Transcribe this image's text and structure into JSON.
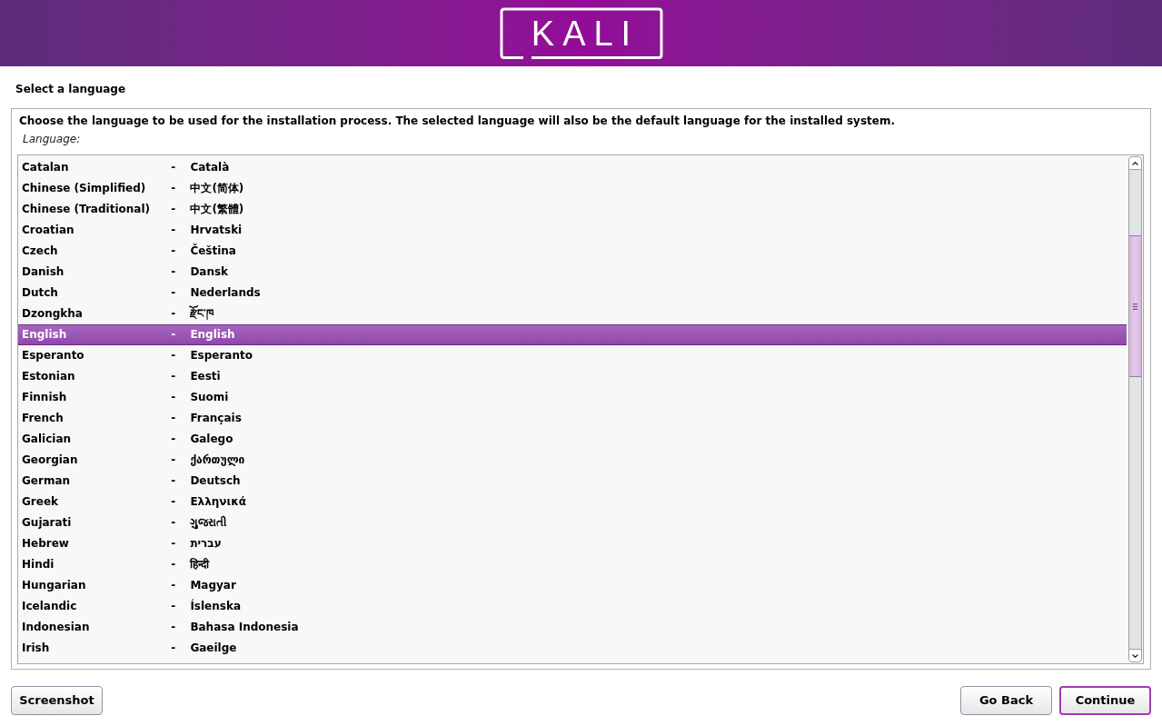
{
  "header": {
    "logo_text": "KALI"
  },
  "page_title": "Select a language",
  "description": "Choose the language to be used for the installation process. The selected language will also be the default language for the installed system.",
  "list_label": "Language:",
  "languages": [
    {
      "name": "Catalan",
      "separator": "-",
      "native": "Català",
      "selected": false
    },
    {
      "name": "Chinese (Simplified)",
      "separator": "-",
      "native": "中文(简体)",
      "selected": false
    },
    {
      "name": "Chinese (Traditional)",
      "separator": "-",
      "native": "中文(繁體)",
      "selected": false
    },
    {
      "name": "Croatian",
      "separator": "-",
      "native": "Hrvatski",
      "selected": false
    },
    {
      "name": "Czech",
      "separator": "-",
      "native": "Čeština",
      "selected": false
    },
    {
      "name": "Danish",
      "separator": "-",
      "native": "Dansk",
      "selected": false
    },
    {
      "name": "Dutch",
      "separator": "-",
      "native": "Nederlands",
      "selected": false
    },
    {
      "name": "Dzongkha",
      "separator": "-",
      "native": "རྫོང་ཁ",
      "selected": false
    },
    {
      "name": "English",
      "separator": "-",
      "native": "English",
      "selected": true
    },
    {
      "name": "Esperanto",
      "separator": "-",
      "native": "Esperanto",
      "selected": false
    },
    {
      "name": "Estonian",
      "separator": "-",
      "native": "Eesti",
      "selected": false
    },
    {
      "name": "Finnish",
      "separator": "-",
      "native": "Suomi",
      "selected": false
    },
    {
      "name": "French",
      "separator": "-",
      "native": "Français",
      "selected": false
    },
    {
      "name": "Galician",
      "separator": "-",
      "native": "Galego",
      "selected": false
    },
    {
      "name": "Georgian",
      "separator": "-",
      "native": "ქართული",
      "selected": false
    },
    {
      "name": "German",
      "separator": "-",
      "native": "Deutsch",
      "selected": false
    },
    {
      "name": "Greek",
      "separator": "-",
      "native": "Ελληνικά",
      "selected": false
    },
    {
      "name": "Gujarati",
      "separator": "-",
      "native": "ગુજરાતી",
      "selected": false
    },
    {
      "name": "Hebrew",
      "separator": "-",
      "native": "עברית",
      "selected": false
    },
    {
      "name": "Hindi",
      "separator": "-",
      "native": "हिन्दी",
      "selected": false
    },
    {
      "name": "Hungarian",
      "separator": "-",
      "native": "Magyar",
      "selected": false
    },
    {
      "name": "Icelandic",
      "separator": "-",
      "native": "Íslenska",
      "selected": false
    },
    {
      "name": "Indonesian",
      "separator": "-",
      "native": "Bahasa Indonesia",
      "selected": false
    },
    {
      "name": "Irish",
      "separator": "-",
      "native": "Gaeilge",
      "selected": false
    }
  ],
  "left_buttons": [
    {
      "label": "Screenshot",
      "focused": false
    }
  ],
  "right_buttons": [
    {
      "label": "Go Back",
      "focused": false
    },
    {
      "label": "Continue",
      "focused": true
    }
  ]
}
